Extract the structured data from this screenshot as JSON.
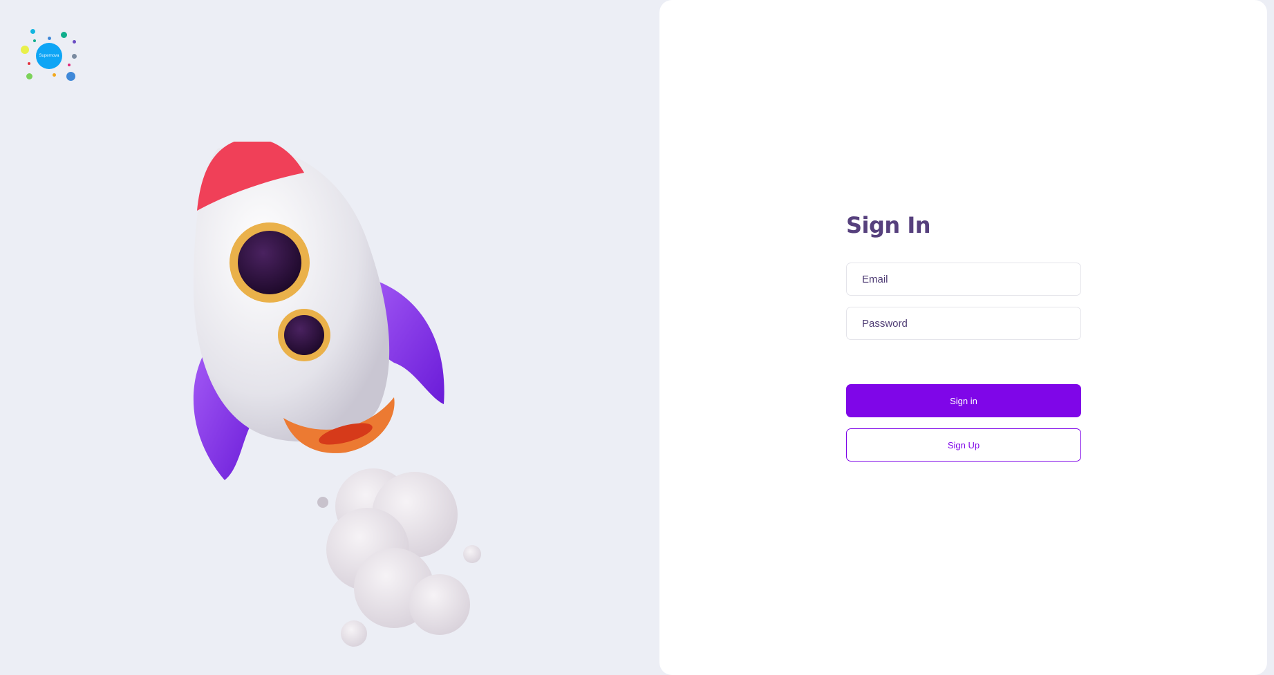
{
  "logo": {
    "text": "Supernova",
    "center_color": "#0ea5f5",
    "dot_colors": [
      "#12b5e0",
      "#a0a8c0",
      "#0fae8c",
      "#6a4cc3",
      "#e8f04a",
      "#7a8aa0",
      "#e3313c",
      "#f2a81d",
      "#e02a7a",
      "#7cd25a",
      "#3f88d8"
    ]
  },
  "illustration": {
    "name": "rocket-illustration",
    "colors": {
      "nose": "#f04058",
      "body": "#ececf0",
      "fins": "#8b3cf0",
      "window_ring": "#eab14a",
      "window_glass": "#2a0f3d",
      "nozzle": "#ec7a32",
      "smoke": "#e9e4ea"
    }
  },
  "form": {
    "title": "Sign In",
    "email_placeholder": "Email",
    "password_placeholder": "Password",
    "signin_label": "Sign in",
    "signup_label": "Sign Up"
  },
  "colors": {
    "accent": "#7f06e8",
    "title": "#56407d",
    "background": "#eceef5",
    "card": "#ffffff"
  }
}
